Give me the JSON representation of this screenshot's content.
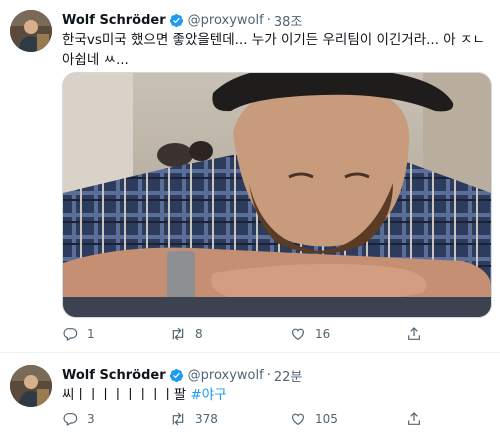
{
  "tweets": [
    {
      "author_name": "Wolf Schröder",
      "handle": "@proxywolf",
      "separator": "·",
      "time": "38조",
      "text_line1": "한국vs미국 했으면 좋았을텐데... 누가 이기든 우리팀이 이긴거라... 아 ㅈㄴ",
      "text_line2": "아쉽네 ㅆ...",
      "replies": "1",
      "retweets": "8",
      "likes": "16",
      "icons": {
        "verified": "verified-badge-icon",
        "reply": "reply-icon",
        "retweet": "retweet-icon",
        "like": "heart-icon",
        "share": "share-icon"
      }
    },
    {
      "author_name": "Wolf Schröder",
      "handle": "@proxywolf",
      "separator": "·",
      "time": "22분",
      "text": "씨ㅣㅣㅣㅣㅣㅣㅣㅣ팔 ",
      "hashtag": "#야구",
      "replies": "3",
      "retweets": "378",
      "likes": "105",
      "icons": {
        "verified": "verified-badge-icon",
        "reply": "reply-icon",
        "retweet": "retweet-icon",
        "like": "heart-icon",
        "share": "share-icon"
      }
    }
  ],
  "colors": {
    "accent": "#1d9bf0",
    "secondary_text": "#536471",
    "primary_text": "#0f1419"
  }
}
